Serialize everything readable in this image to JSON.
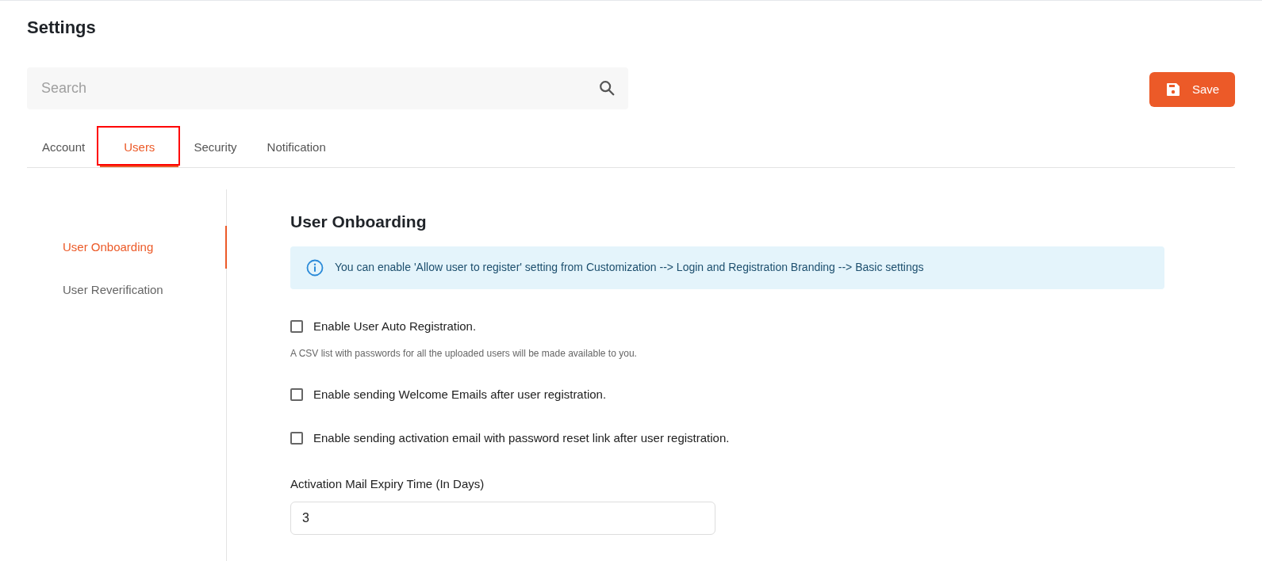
{
  "page_title": "Settings",
  "search": {
    "placeholder": "Search"
  },
  "save_button": "Save",
  "tabs": [
    {
      "label": "Account",
      "selected": false,
      "annotated": false
    },
    {
      "label": "Users",
      "selected": true,
      "annotated": true
    },
    {
      "label": "Security",
      "selected": false,
      "annotated": false
    },
    {
      "label": "Notification",
      "selected": false,
      "annotated": false
    }
  ],
  "sidebar": {
    "items": [
      {
        "label": "User Onboarding",
        "selected": true
      },
      {
        "label": "User Reverification",
        "selected": false
      }
    ]
  },
  "section": {
    "heading": "User Onboarding",
    "info": "You can enable 'Allow user to register' setting from Customization --> Login and Registration Branding --> Basic settings",
    "options": [
      {
        "label": "Enable User Auto Registration.",
        "checked": false,
        "help": "A CSV list with passwords for all the uploaded users will be made available to you."
      },
      {
        "label": "Enable sending Welcome Emails after user registration.",
        "checked": false
      },
      {
        "label": "Enable sending activation email with password reset link after user registration.",
        "checked": false
      }
    ],
    "field": {
      "label": "Activation Mail Expiry Time (In Days)",
      "value": "3"
    }
  }
}
